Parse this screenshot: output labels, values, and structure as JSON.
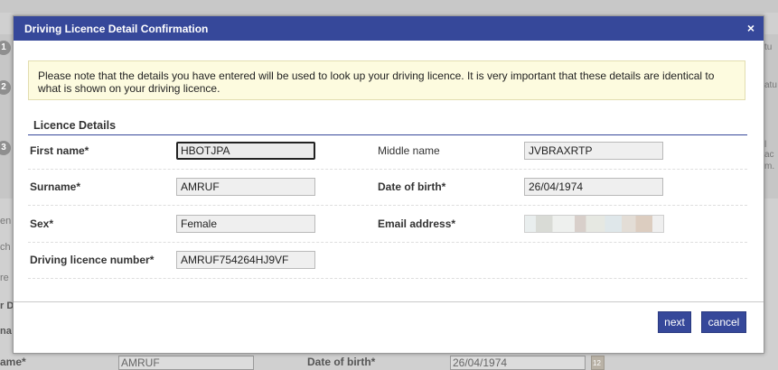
{
  "background": {
    "steps": [
      "1",
      "2",
      "3"
    ],
    "right_fragments": [
      "tu",
      "atu",
      "l ac",
      "m."
    ],
    "left_fragments": [
      "en",
      "ch",
      "re",
      "r D",
      "na"
    ],
    "surname_label": "ame*",
    "surname_value": "AMRUF",
    "dob_label": "Date of birth*",
    "dob_value": "26/04/1974",
    "calendar_day": "12"
  },
  "dialog": {
    "title": "Driving Licence Detail Confirmation",
    "close_symbol": "×",
    "notice": "Please note that the details you have entered will be used to look up your driving licence. It is very important that these details are identical to what is shown on your driving licence.",
    "section_title": "Licence Details",
    "fields": {
      "first_name": {
        "label": "First name*",
        "value": "HBOTJPA"
      },
      "middle_name": {
        "label": "Middle name",
        "value": "JVBRAXRTP"
      },
      "surname": {
        "label": "Surname*",
        "value": "AMRUF"
      },
      "date_of_birth": {
        "label": "Date of birth*",
        "value": "26/04/1974"
      },
      "sex": {
        "label": "Sex*",
        "value": "Female"
      },
      "email": {
        "label": "Email address*",
        "value": ""
      },
      "licence_number": {
        "label": "Driving licence number*",
        "value": "AMRUF754264HJ9VF"
      }
    },
    "buttons": {
      "next": "next",
      "cancel": "cancel"
    }
  },
  "colors": {
    "title_bar": "#36489a",
    "notice_bg": "#fdfbdf",
    "button_bg": "#36489a"
  }
}
